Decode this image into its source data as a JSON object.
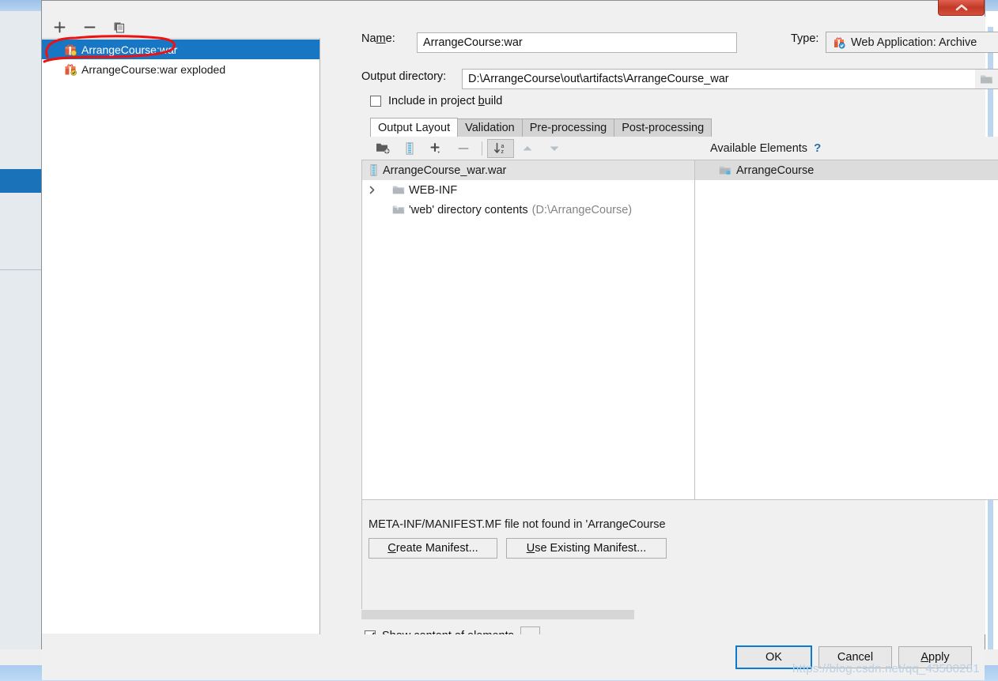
{
  "window": {
    "close_button_icon": "chevron-up-icon"
  },
  "artifacts_pane": {
    "toolbar": [
      {
        "name": "add-artifact-button",
        "icon": "plus-icon",
        "label": "+"
      },
      {
        "name": "remove-artifact-button",
        "icon": "minus-icon",
        "label": "−"
      },
      {
        "name": "copy-artifact-button",
        "icon": "copy-icon",
        "label": "copy"
      }
    ],
    "items": [
      {
        "label": "ArrangeCourse:war",
        "icon": "war-archive-icon",
        "selected": true
      },
      {
        "label": "ArrangeCourse:war exploded",
        "icon": "war-exploded-icon",
        "selected": false
      }
    ]
  },
  "config": {
    "name_label": "Name:",
    "name_label_pre": "Na",
    "name_label_mnemonic": "m",
    "name_label_post": "e:",
    "name_value": "ArrangeCourse:war",
    "type_label": "Type:",
    "type_value": "Web Application: Archive",
    "type_icon": "web-archive-icon",
    "type_chevron": "chevron-down-icon",
    "output_directory_label": "Output directory:",
    "output_directory_value": "D:\\ArrangeCourse\\out\\artifacts\\ArrangeCourse_war",
    "browse_icon": "folder-icon",
    "include_in_build_pre": "Include in project ",
    "include_in_build_mnemonic": "b",
    "include_in_build_post": "uild",
    "include_in_build_checked": false,
    "tabs": [
      {
        "label": "Output Layout",
        "active": true
      },
      {
        "label": "Validation",
        "active": false
      },
      {
        "label": "Pre-processing",
        "active": false
      },
      {
        "label": "Post-processing",
        "active": false
      }
    ]
  },
  "layout_toolbar": [
    {
      "name": "add-directory-button",
      "icon": "add-folder-icon"
    },
    {
      "name": "add-archive-button",
      "icon": "archive-icon"
    },
    {
      "name": "add-copy-button",
      "icon": "plus-dropdown-icon"
    },
    {
      "name": "remove-element-button",
      "icon": "minus-icon"
    },
    {
      "name": "sort-button",
      "icon": "sort-az-icon",
      "pressed": true
    },
    {
      "name": "move-up-button",
      "icon": "triangle-up-icon"
    },
    {
      "name": "move-down-button",
      "icon": "triangle-down-icon"
    }
  ],
  "output_layout": {
    "rows": [
      {
        "label": "ArrangeCourse_war.war",
        "suffix": "",
        "icon": "archive-icon",
        "indent": 0,
        "expander": "none",
        "header": true
      },
      {
        "label": "WEB-INF",
        "suffix": "",
        "icon": "folder-icon",
        "indent": 0,
        "expander": "collapsed",
        "header": false
      },
      {
        "label": "'web' directory contents",
        "suffix": "(D:\\ArrangeCourse)",
        "icon": "folder-link-icon",
        "indent": 0,
        "expander": "none",
        "header": false
      }
    ]
  },
  "available_elements": {
    "title": "Available Elements",
    "help_icon": "question-mark-icon",
    "rows": [
      {
        "label": "ArrangeCourse",
        "icon": "module-folder-icon"
      }
    ]
  },
  "manifest": {
    "message": "META-INF/MANIFEST.MF file not found in 'ArrangeCourse",
    "create_button_pre": "",
    "create_button_mnemonic": "C",
    "create_button_post": "reate Manifest...",
    "use_existing_mnemonic": "U",
    "use_existing_post": "se Existing Manifest..."
  },
  "footer_options": {
    "show_content_label": "Show content of elements",
    "show_content_checked": true,
    "ellipsis_label": "..."
  },
  "dialog_buttons": [
    {
      "name": "ok-button",
      "label": "OK",
      "default": true,
      "mnemonic": ""
    },
    {
      "name": "cancel-button",
      "label": "Cancel",
      "default": false,
      "mnemonic": ""
    },
    {
      "name": "apply-button",
      "label": "Apply",
      "default": false,
      "mnemonic": "A"
    }
  ],
  "watermark": "https://blog.csdn.net/qq_43580281"
}
